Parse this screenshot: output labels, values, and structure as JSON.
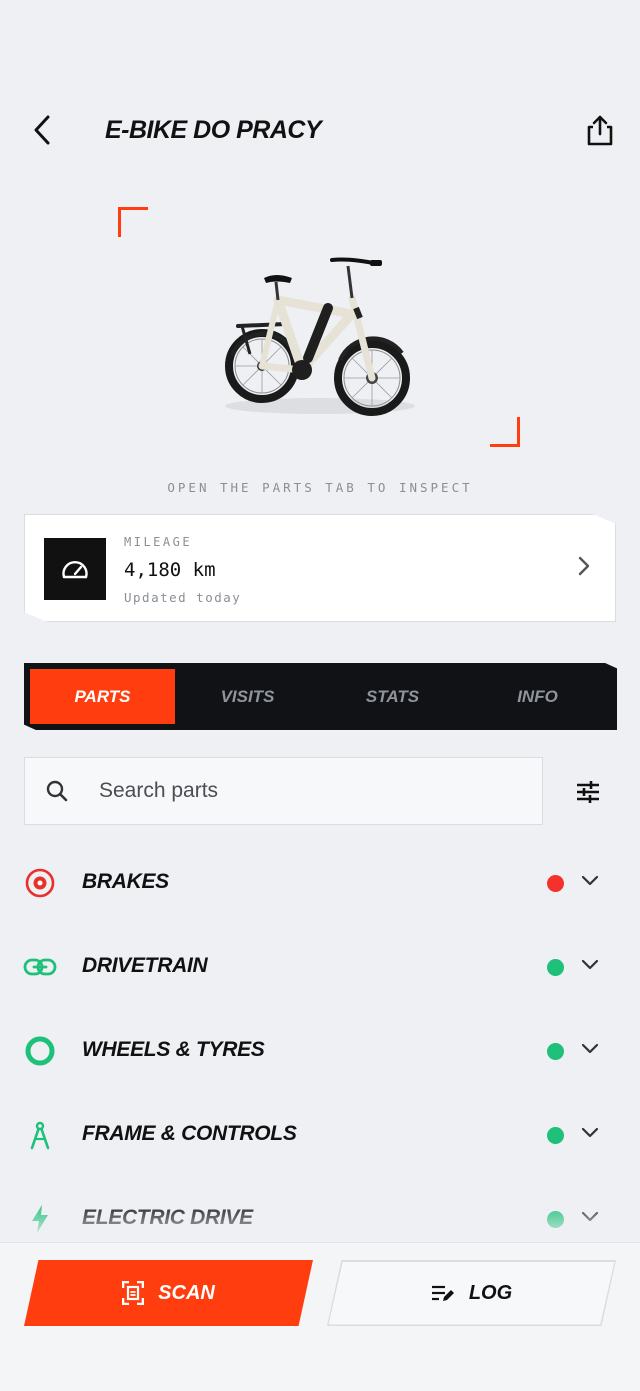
{
  "header": {
    "title": "E-BIKE DO PRACY",
    "back_icon": "chevron-left-icon",
    "share_icon": "share-icon"
  },
  "hero": {
    "image": "e-bike-photo",
    "hint": "OPEN THE PARTS TAB TO INSPECT",
    "accent_color": "#ff3d0f"
  },
  "mileage": {
    "label": "MILEAGE",
    "value": "4,180 km",
    "updated": "Updated today",
    "icon": "speedometer-icon"
  },
  "tabs": [
    {
      "label": "PARTS",
      "active": true
    },
    {
      "label": "VISITS",
      "active": false
    },
    {
      "label": "STATS",
      "active": false
    },
    {
      "label": "INFO",
      "active": false
    }
  ],
  "search": {
    "placeholder": "Search parts",
    "value": ""
  },
  "parts": [
    {
      "name": "BRAKES",
      "icon": "target-icon",
      "status": "red",
      "status_color": "#f4322b",
      "icon_color": "#e8312a"
    },
    {
      "name": "DRIVETRAIN",
      "icon": "chain-link-icon",
      "status": "green",
      "status_color": "#1ec07a",
      "icon_color": "#1ec07a"
    },
    {
      "name": "WHEELS & TYRES",
      "icon": "ring-icon",
      "status": "green",
      "status_color": "#1ec07a",
      "icon_color": "#1ec07a"
    },
    {
      "name": "FRAME & CONTROLS",
      "icon": "compass-icon",
      "status": "green",
      "status_color": "#1ec07a",
      "icon_color": "#1ec07a"
    },
    {
      "name": "ELECTRIC DRIVE",
      "icon": "lightning-icon",
      "status": "green",
      "status_color": "#1ec07a",
      "icon_color": "#1ec07a"
    }
  ],
  "actions": {
    "scan_label": "SCAN",
    "log_label": "LOG",
    "scan_color": "#ff3d0f"
  }
}
